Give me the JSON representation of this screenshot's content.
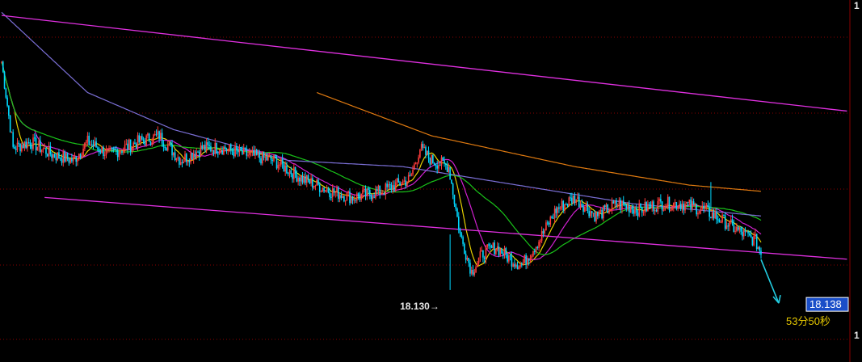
{
  "chart_data": {
    "type": "candlestick",
    "title": "",
    "xlabel": "",
    "ylabel": "",
    "ylim": [
      18.05,
      18.6
    ],
    "grid": true,
    "legend": "none",
    "colors": {
      "background": "#000000",
      "grid": "#8a0000",
      "up_candle": "#ff3b3b",
      "down_candle": "#00d8ff",
      "ma_yellow": "#e6d000",
      "ma_magenta": "#d020d0",
      "ma_green": "#19c419",
      "ma_purple": "#7b6fd6",
      "ma_orange": "#e07a10",
      "channel": "#e030e0",
      "arrow": "#22cce0",
      "price_box_bg": "#1a4ec8",
      "price_box_border": "#ffffff",
      "countdown_text": "#e6c800",
      "low_marker_text": "#e8e8e8"
    },
    "close_anchors": [
      [
        0,
        18.5
      ],
      [
        8,
        18.36
      ],
      [
        20,
        18.37
      ],
      [
        35,
        18.35
      ],
      [
        50,
        18.34
      ],
      [
        60,
        18.37
      ],
      [
        75,
        18.35
      ],
      [
        95,
        18.37
      ],
      [
        110,
        18.38
      ],
      [
        125,
        18.34
      ],
      [
        140,
        18.36
      ],
      [
        155,
        18.36
      ],
      [
        170,
        18.35
      ],
      [
        190,
        18.34
      ],
      [
        210,
        18.31
      ],
      [
        230,
        18.29
      ],
      [
        245,
        18.28
      ],
      [
        265,
        18.29
      ],
      [
        285,
        18.31
      ],
      [
        292,
        18.36
      ],
      [
        300,
        18.34
      ],
      [
        312,
        18.33
      ],
      [
        320,
        18.22
      ],
      [
        328,
        18.16
      ],
      [
        336,
        18.19
      ],
      [
        345,
        18.2
      ],
      [
        355,
        18.18
      ],
      [
        363,
        18.17
      ],
      [
        375,
        18.21
      ],
      [
        387,
        18.26
      ],
      [
        400,
        18.28
      ],
      [
        415,
        18.25
      ],
      [
        430,
        18.27
      ],
      [
        445,
        18.26
      ],
      [
        460,
        18.27
      ],
      [
        475,
        18.27
      ],
      [
        490,
        18.26
      ],
      [
        505,
        18.24
      ],
      [
        518,
        18.22
      ],
      [
        526,
        18.21
      ],
      [
        530,
        18.19
      ]
    ],
    "moving_averages": [
      {
        "color": "yellow",
        "period": 10
      },
      {
        "color": "magenta",
        "period": 24
      },
      {
        "color": "green",
        "period": 60
      },
      {
        "color": "purple",
        "period": 120
      }
    ],
    "long_ma_anchors": [
      {
        "color": "orange",
        "points": [
          [
            220,
            18.45
          ],
          [
            300,
            18.38
          ],
          [
            400,
            18.33
          ],
          [
            480,
            18.3
          ],
          [
            530,
            18.29
          ]
        ]
      },
      {
        "color": "purple",
        "points": [
          [
            0,
            18.58
          ],
          [
            60,
            18.45
          ],
          [
            120,
            18.39
          ],
          [
            200,
            18.34
          ],
          [
            280,
            18.33
          ],
          [
            360,
            18.3
          ],
          [
            440,
            18.27
          ],
          [
            530,
            18.25
          ]
        ]
      }
    ],
    "channel_lines": [
      {
        "from": [
          0,
          18.575
        ],
        "to": [
          590,
          18.42
        ]
      },
      {
        "from": [
          30,
          18.28
        ],
        "to": [
          590,
          18.18
        ]
      }
    ],
    "spikes": [
      {
        "index": 313,
        "high": 18.22,
        "low": 18.13
      },
      {
        "index": 495,
        "high": 18.305,
        "low": 18.26
      }
    ],
    "annotations": {
      "low_marker": {
        "text": "18.130→",
        "value": 18.13
      },
      "price_label": "18.138",
      "countdown": "53分50秒",
      "right_axis_top": "1",
      "right_axis_bottom": "1"
    }
  }
}
